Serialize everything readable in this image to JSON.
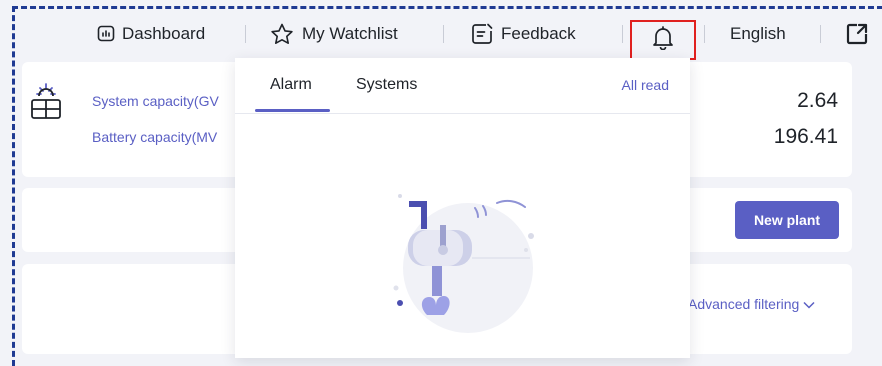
{
  "nav": {
    "dashboard_label": "Dashboard",
    "watchlist_label": "My Watchlist",
    "feedback_label": "Feedback",
    "language_label": "English"
  },
  "stats": {
    "system_capacity_label": "System capacity(GV",
    "system_capacity_value": "2.64",
    "battery_capacity_label": "Battery capacity(MV",
    "battery_capacity_value": "196.41"
  },
  "actions": {
    "new_plant_label": "New plant",
    "advanced_filter_label": "Advanced filtering"
  },
  "notifications": {
    "tabs": [
      "Alarm",
      "Systems"
    ],
    "active_tab": "Alarm",
    "all_read_label": "All read"
  },
  "colors": {
    "accent": "#5a5fc4",
    "highlight": "#e0201f",
    "background": "#f2f3f8"
  },
  "icons": {
    "dashboard": "dashboard-icon",
    "watchlist": "star-icon",
    "feedback": "feedback-icon",
    "notifications": "bell-icon",
    "external": "external-link-icon",
    "solar": "solar-panel-icon",
    "empty_state": "mailbox-illustration"
  }
}
